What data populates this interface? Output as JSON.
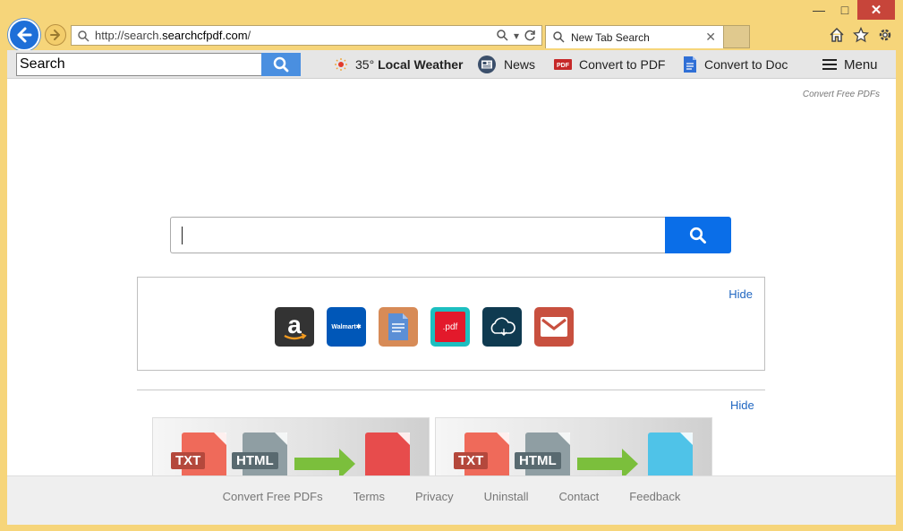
{
  "window": {
    "minimize": "—",
    "maximize": "□",
    "close": "✕"
  },
  "address_bar": {
    "url_prefix": "http://search.",
    "url_domain": "searchcfpdf.com",
    "url_suffix": "/"
  },
  "tab": {
    "title": "New Tab Search",
    "close": "✕"
  },
  "toolbar": {
    "search_value": "Search",
    "weather_temp": "35°",
    "weather_label": "Local Weather",
    "news_label": "News",
    "convert_pdf_label": "Convert to PDF",
    "convert_doc_label": "Convert to Doc",
    "menu_label": "Menu"
  },
  "page": {
    "brand": "Convert Free PDFs",
    "search_value": "",
    "quick_links": {
      "hide_label": "Hide",
      "tiles": [
        {
          "name": "amazon",
          "label": "a",
          "color": "#333333"
        },
        {
          "name": "walmart",
          "label": "Walmart✱",
          "color": "#0057b8"
        },
        {
          "name": "docs",
          "label": "",
          "color": "#d78b57"
        },
        {
          "name": "pdf",
          "label": ".pdf",
          "color": "#1cbfc0"
        },
        {
          "name": "cloud",
          "label": "",
          "color": "#0f3a50"
        },
        {
          "name": "mail",
          "label": "",
          "color": "#c8503f"
        }
      ]
    },
    "promo": {
      "hide_label": "Hide",
      "txt_label": "TXT",
      "html_label": "HTML"
    }
  },
  "footer": {
    "links": [
      "Convert Free PDFs",
      "Terms",
      "Privacy",
      "Uninstall",
      "Contact",
      "Feedback"
    ]
  },
  "colors": {
    "chrome": "#f6d57a",
    "accent_blue": "#0a6ee8",
    "link_blue": "#1f66c1"
  }
}
